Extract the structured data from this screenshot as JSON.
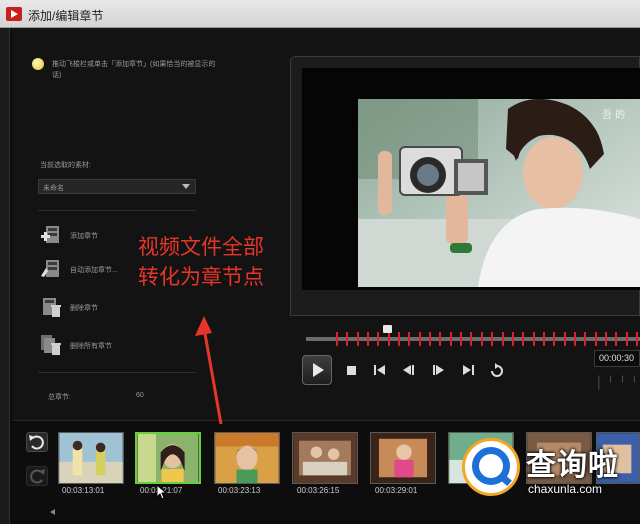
{
  "window": {
    "title": "添加/编辑章节"
  },
  "panel": {
    "tip": "推动飞梭栏或单击「添加章节」(如果恰当的被显示的话)",
    "current_label": "当前选取的素材:",
    "select_value": "未命名",
    "actions": [
      {
        "label": "添加章节",
        "icon": "add-chapter-icon"
      },
      {
        "label": "自动添加章节...",
        "icon": "auto-add-chapter-icon"
      },
      {
        "label": "删除章节",
        "icon": "delete-chapter-icon"
      },
      {
        "label": "删除所有章节",
        "icon": "delete-all-chapters-icon"
      }
    ],
    "total_label": "总章节:",
    "total_value": "60"
  },
  "preview": {
    "corner_text": "吾 的",
    "time": "00:00:30",
    "chapter_mark_count": 30
  },
  "thumbnails": [
    {
      "time": "00:03:13:01",
      "selected": false
    },
    {
      "time": "00:03:21:07",
      "selected": true
    },
    {
      "time": "00:03:23:13",
      "selected": false
    },
    {
      "time": "00:03:26:15",
      "selected": false
    },
    {
      "time": "00:03:29:01",
      "selected": false
    },
    {
      "time": "",
      "selected": false
    },
    {
      "time": "",
      "selected": false
    },
    {
      "time": "",
      "selected": false
    }
  ],
  "annotation": {
    "line1": "视频文件全部",
    "line2": "转化为章节点"
  },
  "watermark": {
    "title": "查询啦",
    "url": "chaxunla.com"
  },
  "colors": {
    "accent_red": "#e8352a",
    "selection_green": "#65d23c",
    "chapter_mark": "#d8222a"
  }
}
